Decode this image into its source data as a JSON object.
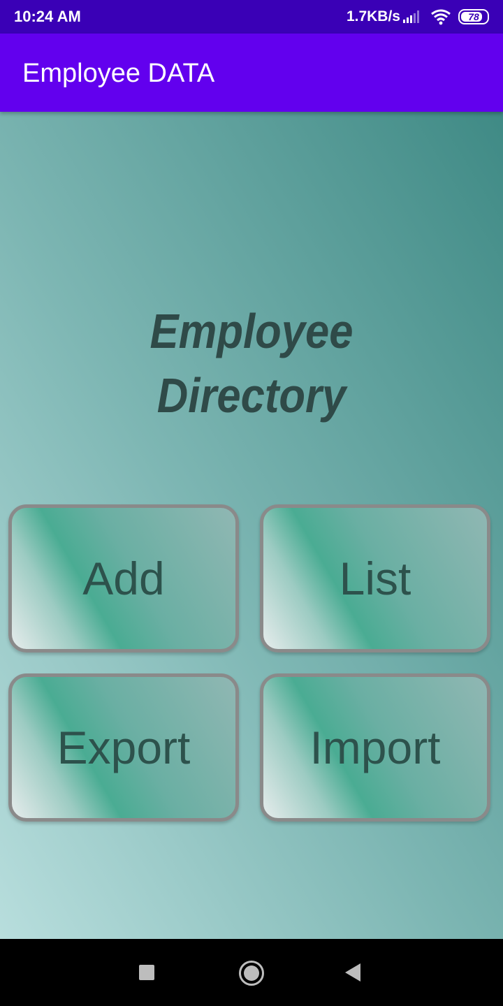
{
  "status_bar": {
    "time": "10:24 AM",
    "net_speed": "1.7KB/s",
    "battery": "78",
    "icons": [
      "signal-icon",
      "wifi-icon",
      "battery-icon"
    ]
  },
  "app_bar": {
    "title": "Employee DATA",
    "color": "#6200ee"
  },
  "main": {
    "heading_line1": "Employee",
    "heading_line2": "Directory",
    "buttons": {
      "add": "Add",
      "list": "List",
      "export": "Export",
      "import": "Import"
    }
  },
  "nav_bar": {
    "icons": [
      "recents-square-icon",
      "home-circle-icon",
      "back-triangle-icon"
    ]
  }
}
